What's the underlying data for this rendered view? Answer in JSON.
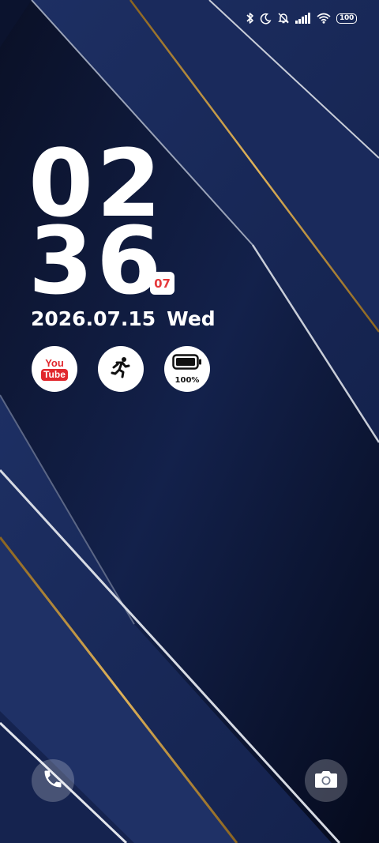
{
  "status_bar": {
    "icons": [
      "bluetooth-icon",
      "moon-icon",
      "bell-off-icon",
      "signal-icon",
      "wifi-icon",
      "battery-icon"
    ],
    "battery": "100"
  },
  "clock": {
    "hours": "02",
    "minutes": "36",
    "day_badge": "07"
  },
  "date": {
    "full": "2026.07.15",
    "weekday": "Wed"
  },
  "widgets": {
    "youtube": {
      "line1": "You",
      "line2": "Tube",
      "icon": "youtube-icon"
    },
    "fitness": {
      "icon": "running-icon"
    },
    "battery": {
      "level": "100%",
      "icon": "battery-icon"
    }
  },
  "shortcuts": {
    "left": "phone-icon",
    "right": "camera-icon"
  },
  "colors": {
    "wallpaper_dark": "#050b20",
    "wallpaper_navy": "#18295a",
    "gold": "#c9973a",
    "badge_red": "#e5393b",
    "youtube_red": "#e1272d"
  }
}
